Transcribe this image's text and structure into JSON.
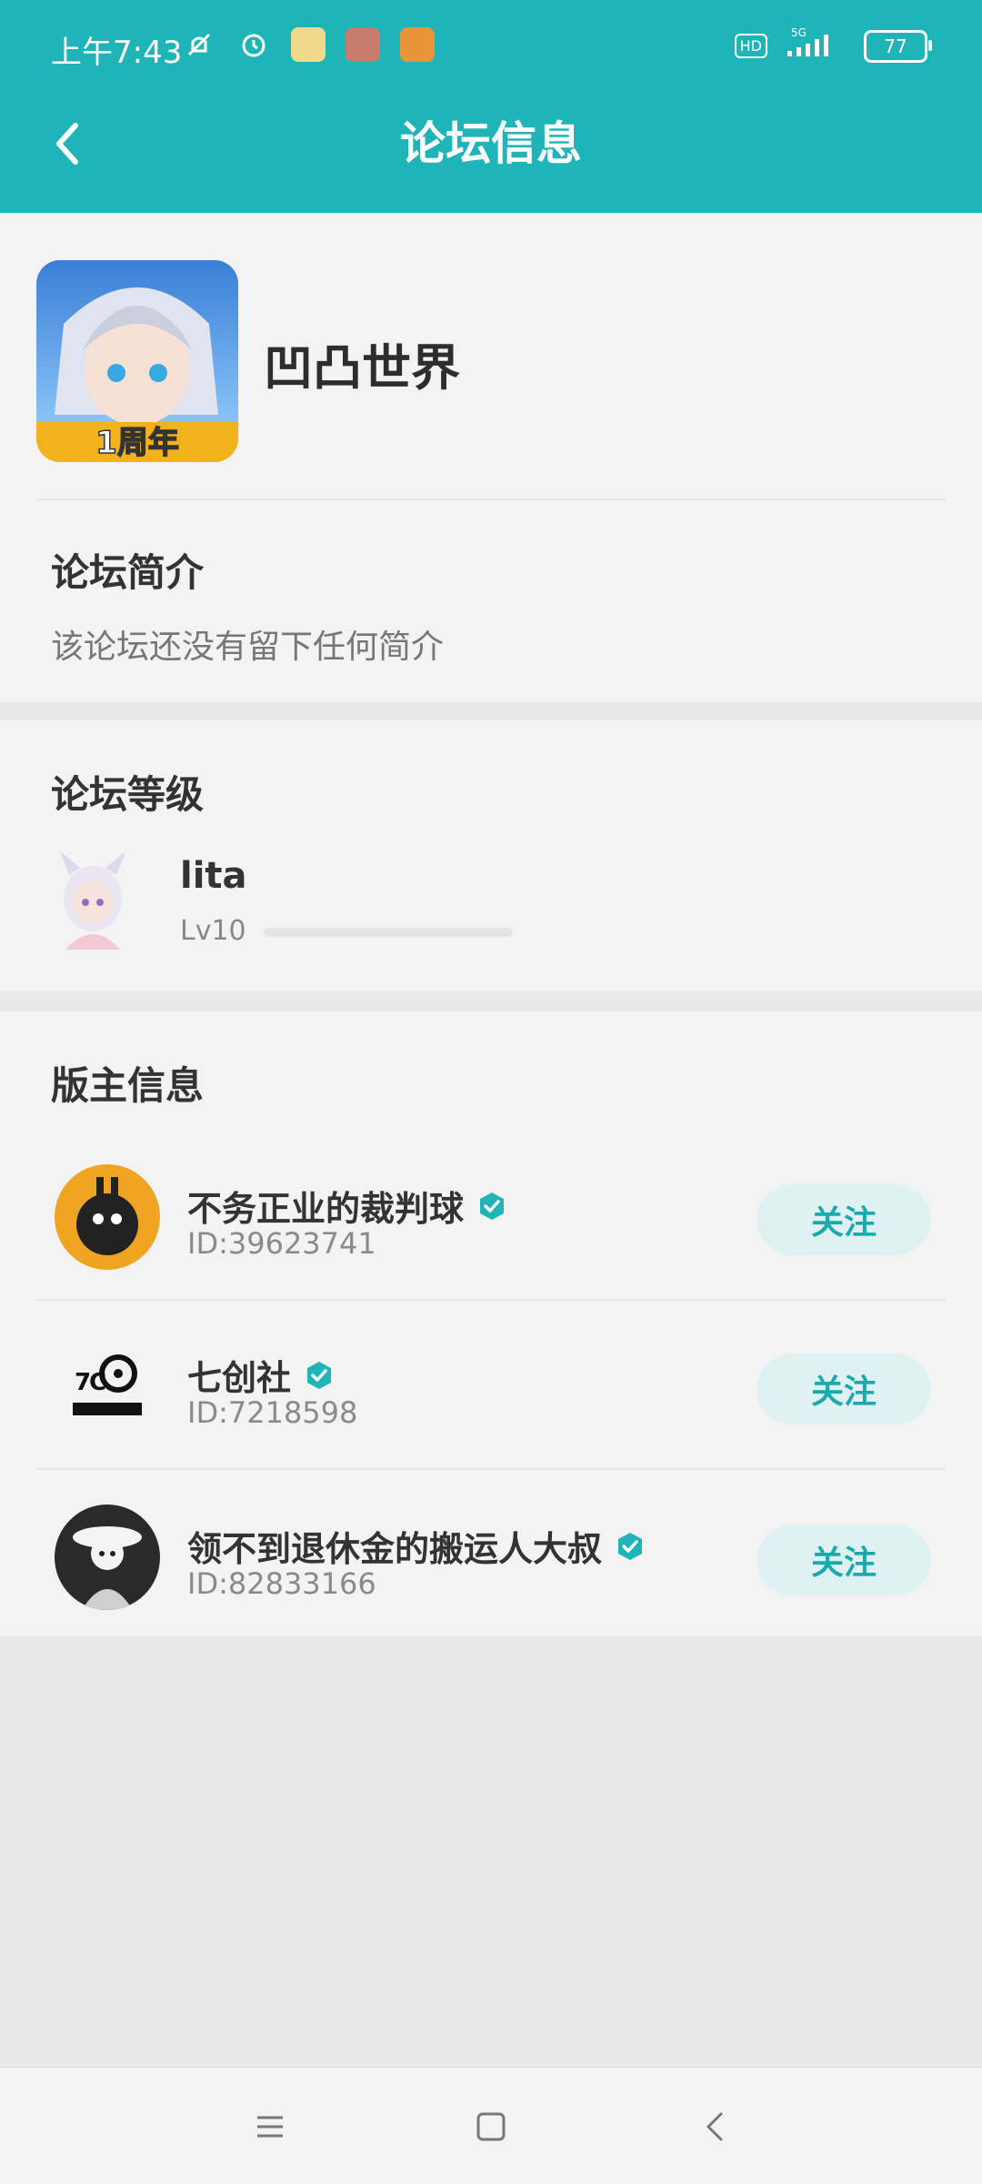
{
  "status_bar": {
    "time": "上午7:43",
    "hd": "HD",
    "network": "5G",
    "battery": "77"
  },
  "header": {
    "title": "论坛信息"
  },
  "forum": {
    "name": "凹凸世界",
    "avatar_badge": "1周年",
    "intro_title": "论坛简介",
    "intro_text": "该论坛还没有留下任何简介"
  },
  "level": {
    "title": "论坛等级",
    "user": "lita",
    "label": "Lv10",
    "progress": 0.0
  },
  "moderators": {
    "title": "版主信息",
    "items": [
      {
        "name": "不务正业的裁判球",
        "id": "ID:39623741",
        "follow": "关注"
      },
      {
        "name": "七创社",
        "id": "ID:7218598",
        "follow": "关注"
      },
      {
        "name": "领不到退休金的搬运人大叔",
        "id": "ID:82833166",
        "follow": "关注"
      }
    ]
  },
  "colors": {
    "accent": "#1fb4b8",
    "follow_bg": "#dff1f2"
  }
}
